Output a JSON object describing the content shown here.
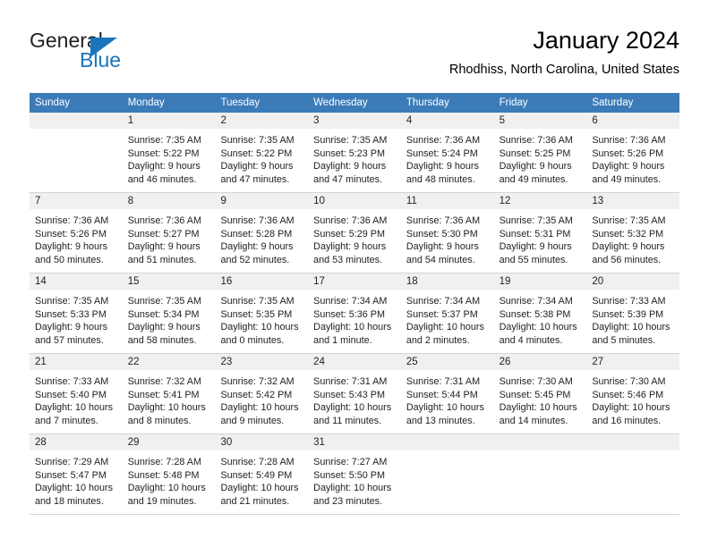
{
  "brand": {
    "name_part1": "General",
    "name_part2": "Blue",
    "accent_color": "#1b75bb"
  },
  "header": {
    "title": "January 2024",
    "location": "Rhodhiss, North Carolina, United States"
  },
  "colors": {
    "header_row": "#3b7cb8",
    "day_strip": "#f0f0f0",
    "grid_line": "#d4d4d4",
    "text": "#222222"
  },
  "weekdays": [
    "Sunday",
    "Monday",
    "Tuesday",
    "Wednesday",
    "Thursday",
    "Friday",
    "Saturday"
  ],
  "weeks": [
    [
      {
        "day": "",
        "lines": [
          "",
          "",
          "",
          ""
        ]
      },
      {
        "day": "1",
        "lines": [
          "Sunrise: 7:35 AM",
          "Sunset: 5:22 PM",
          "Daylight: 9 hours",
          "and 46 minutes."
        ]
      },
      {
        "day": "2",
        "lines": [
          "Sunrise: 7:35 AM",
          "Sunset: 5:22 PM",
          "Daylight: 9 hours",
          "and 47 minutes."
        ]
      },
      {
        "day": "3",
        "lines": [
          "Sunrise: 7:35 AM",
          "Sunset: 5:23 PM",
          "Daylight: 9 hours",
          "and 47 minutes."
        ]
      },
      {
        "day": "4",
        "lines": [
          "Sunrise: 7:36 AM",
          "Sunset: 5:24 PM",
          "Daylight: 9 hours",
          "and 48 minutes."
        ]
      },
      {
        "day": "5",
        "lines": [
          "Sunrise: 7:36 AM",
          "Sunset: 5:25 PM",
          "Daylight: 9 hours",
          "and 49 minutes."
        ]
      },
      {
        "day": "6",
        "lines": [
          "Sunrise: 7:36 AM",
          "Sunset: 5:26 PM",
          "Daylight: 9 hours",
          "and 49 minutes."
        ]
      }
    ],
    [
      {
        "day": "7",
        "lines": [
          "Sunrise: 7:36 AM",
          "Sunset: 5:26 PM",
          "Daylight: 9 hours",
          "and 50 minutes."
        ]
      },
      {
        "day": "8",
        "lines": [
          "Sunrise: 7:36 AM",
          "Sunset: 5:27 PM",
          "Daylight: 9 hours",
          "and 51 minutes."
        ]
      },
      {
        "day": "9",
        "lines": [
          "Sunrise: 7:36 AM",
          "Sunset: 5:28 PM",
          "Daylight: 9 hours",
          "and 52 minutes."
        ]
      },
      {
        "day": "10",
        "lines": [
          "Sunrise: 7:36 AM",
          "Sunset: 5:29 PM",
          "Daylight: 9 hours",
          "and 53 minutes."
        ]
      },
      {
        "day": "11",
        "lines": [
          "Sunrise: 7:36 AM",
          "Sunset: 5:30 PM",
          "Daylight: 9 hours",
          "and 54 minutes."
        ]
      },
      {
        "day": "12",
        "lines": [
          "Sunrise: 7:35 AM",
          "Sunset: 5:31 PM",
          "Daylight: 9 hours",
          "and 55 minutes."
        ]
      },
      {
        "day": "13",
        "lines": [
          "Sunrise: 7:35 AM",
          "Sunset: 5:32 PM",
          "Daylight: 9 hours",
          "and 56 minutes."
        ]
      }
    ],
    [
      {
        "day": "14",
        "lines": [
          "Sunrise: 7:35 AM",
          "Sunset: 5:33 PM",
          "Daylight: 9 hours",
          "and 57 minutes."
        ]
      },
      {
        "day": "15",
        "lines": [
          "Sunrise: 7:35 AM",
          "Sunset: 5:34 PM",
          "Daylight: 9 hours",
          "and 58 minutes."
        ]
      },
      {
        "day": "16",
        "lines": [
          "Sunrise: 7:35 AM",
          "Sunset: 5:35 PM",
          "Daylight: 10 hours",
          "and 0 minutes."
        ]
      },
      {
        "day": "17",
        "lines": [
          "Sunrise: 7:34 AM",
          "Sunset: 5:36 PM",
          "Daylight: 10 hours",
          "and 1 minute."
        ]
      },
      {
        "day": "18",
        "lines": [
          "Sunrise: 7:34 AM",
          "Sunset: 5:37 PM",
          "Daylight: 10 hours",
          "and 2 minutes."
        ]
      },
      {
        "day": "19",
        "lines": [
          "Sunrise: 7:34 AM",
          "Sunset: 5:38 PM",
          "Daylight: 10 hours",
          "and 4 minutes."
        ]
      },
      {
        "day": "20",
        "lines": [
          "Sunrise: 7:33 AM",
          "Sunset: 5:39 PM",
          "Daylight: 10 hours",
          "and 5 minutes."
        ]
      }
    ],
    [
      {
        "day": "21",
        "lines": [
          "Sunrise: 7:33 AM",
          "Sunset: 5:40 PM",
          "Daylight: 10 hours",
          "and 7 minutes."
        ]
      },
      {
        "day": "22",
        "lines": [
          "Sunrise: 7:32 AM",
          "Sunset: 5:41 PM",
          "Daylight: 10 hours",
          "and 8 minutes."
        ]
      },
      {
        "day": "23",
        "lines": [
          "Sunrise: 7:32 AM",
          "Sunset: 5:42 PM",
          "Daylight: 10 hours",
          "and 9 minutes."
        ]
      },
      {
        "day": "24",
        "lines": [
          "Sunrise: 7:31 AM",
          "Sunset: 5:43 PM",
          "Daylight: 10 hours",
          "and 11 minutes."
        ]
      },
      {
        "day": "25",
        "lines": [
          "Sunrise: 7:31 AM",
          "Sunset: 5:44 PM",
          "Daylight: 10 hours",
          "and 13 minutes."
        ]
      },
      {
        "day": "26",
        "lines": [
          "Sunrise: 7:30 AM",
          "Sunset: 5:45 PM",
          "Daylight: 10 hours",
          "and 14 minutes."
        ]
      },
      {
        "day": "27",
        "lines": [
          "Sunrise: 7:30 AM",
          "Sunset: 5:46 PM",
          "Daylight: 10 hours",
          "and 16 minutes."
        ]
      }
    ],
    [
      {
        "day": "28",
        "lines": [
          "Sunrise: 7:29 AM",
          "Sunset: 5:47 PM",
          "Daylight: 10 hours",
          "and 18 minutes."
        ]
      },
      {
        "day": "29",
        "lines": [
          "Sunrise: 7:28 AM",
          "Sunset: 5:48 PM",
          "Daylight: 10 hours",
          "and 19 minutes."
        ]
      },
      {
        "day": "30",
        "lines": [
          "Sunrise: 7:28 AM",
          "Sunset: 5:49 PM",
          "Daylight: 10 hours",
          "and 21 minutes."
        ]
      },
      {
        "day": "31",
        "lines": [
          "Sunrise: 7:27 AM",
          "Sunset: 5:50 PM",
          "Daylight: 10 hours",
          "and 23 minutes."
        ]
      },
      {
        "day": "",
        "lines": [
          "",
          "",
          "",
          ""
        ]
      },
      {
        "day": "",
        "lines": [
          "",
          "",
          "",
          ""
        ]
      },
      {
        "day": "",
        "lines": [
          "",
          "",
          "",
          ""
        ]
      }
    ]
  ]
}
